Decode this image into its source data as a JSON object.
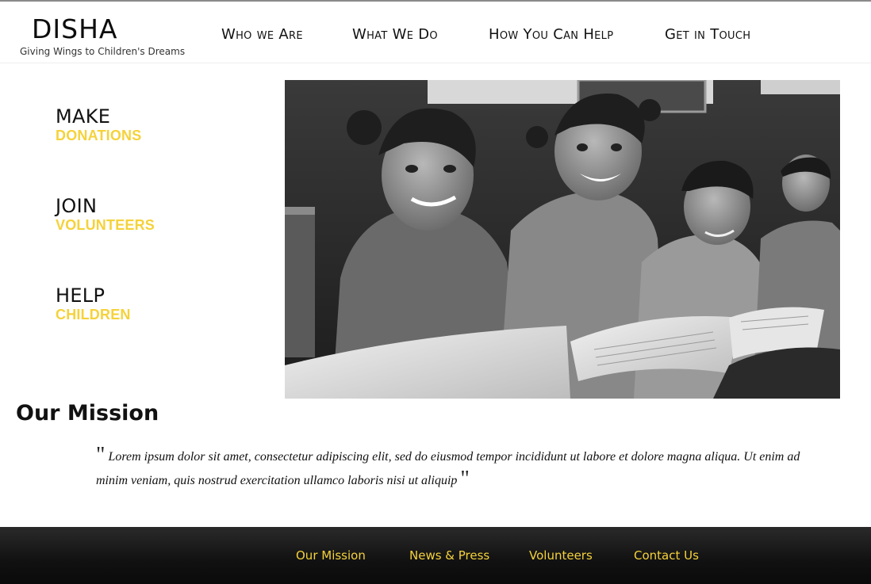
{
  "brand": {
    "title": "DISHA",
    "tagline": "Giving Wings to Children's Dreams"
  },
  "nav": {
    "items": [
      {
        "label": "Who we Are"
      },
      {
        "label": "What We Do"
      },
      {
        "label": "How You Can Help"
      },
      {
        "label": "Get in Touch"
      }
    ]
  },
  "cta": [
    {
      "main": "MAKE",
      "sub": "DONATIONS"
    },
    {
      "main": "JOIN",
      "sub": "VOLUNTEERS"
    },
    {
      "main": "HELP",
      "sub": "CHILDREN"
    }
  ],
  "hero": {
    "description_icon": "photo-children-reading"
  },
  "mission": {
    "title": "Our Mission",
    "open_quote": "\"",
    "text": "Lorem ipsum dolor sit amet, consectetur adipiscing elit, sed do eiusmod tempor incididunt ut labore et dolore magna aliqua. Ut enim ad minim veniam, quis nostrud exercitation ullamco laboris nisi ut aliquip",
    "close_quote": "\""
  },
  "footer": {
    "items": [
      {
        "label": "Our Mission"
      },
      {
        "label": "News & Press"
      },
      {
        "label": "Volunteers"
      },
      {
        "label": "Contact Us"
      }
    ]
  },
  "colors": {
    "accent": "#f5d23a",
    "footer_bg": "#111111",
    "text": "#111111"
  }
}
